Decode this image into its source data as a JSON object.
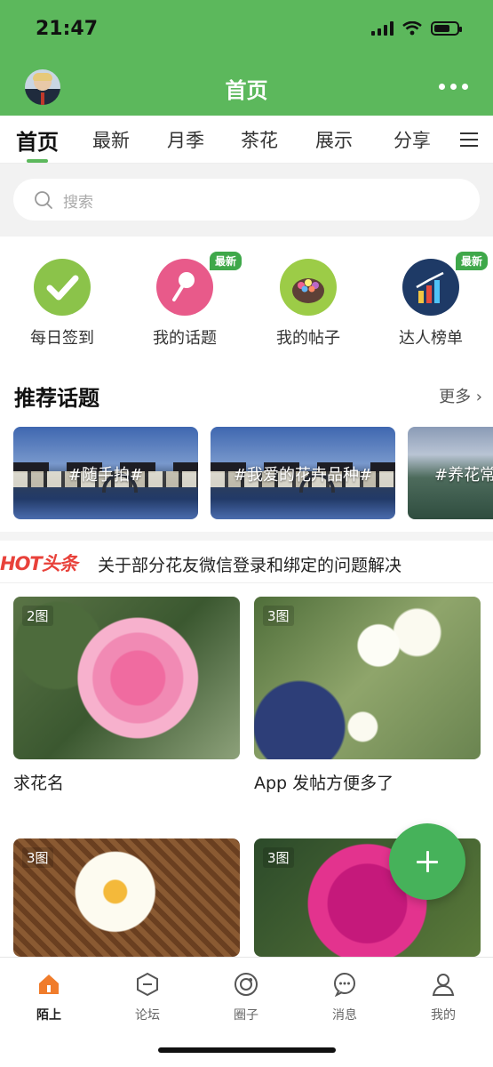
{
  "status_bar": {
    "time": "21:47"
  },
  "header": {
    "title": "首页",
    "more_icon": "more-dots-icon"
  },
  "tabs": [
    {
      "label": "首页",
      "active": true
    },
    {
      "label": "最新"
    },
    {
      "label": "月季"
    },
    {
      "label": "茶花"
    },
    {
      "label": "展示"
    },
    {
      "label": "分享"
    }
  ],
  "search": {
    "placeholder": "搜索"
  },
  "quick_actions": [
    {
      "label": "每日签到",
      "icon": "checkmark-icon"
    },
    {
      "label": "我的话题",
      "icon": "pin-icon",
      "badge": "最新"
    },
    {
      "label": "我的帖子",
      "icon": "flower-basket-icon"
    },
    {
      "label": "达人榜单",
      "icon": "bar-chart-icon",
      "badge": "最新"
    }
  ],
  "recommended": {
    "title": "推荐话题",
    "more": "更多 ›",
    "topics": [
      "#随手拍#",
      "#我爱的花卉品种#",
      "#养花常"
    ]
  },
  "hot": {
    "logo": "HOT头条",
    "headline": "关于部分花友微信登录和绑定的问题解决"
  },
  "posts": [
    {
      "count": "2图",
      "title": "求花名"
    },
    {
      "count": "3图",
      "title": "App 发帖方便多了"
    },
    {
      "count": "3图",
      "title": ""
    },
    {
      "count": "3图",
      "title": ""
    }
  ],
  "bottom_nav": [
    {
      "label": "陌上",
      "icon": "home-icon",
      "active": true
    },
    {
      "label": "论坛",
      "icon": "forum-icon"
    },
    {
      "label": "圈子",
      "icon": "circle-icon"
    },
    {
      "label": "消息",
      "icon": "message-icon"
    },
    {
      "label": "我的",
      "icon": "profile-icon"
    }
  ],
  "colors": {
    "brand_green": "#5cb85c",
    "hot_red": "#e8413a",
    "nav_active": "#f07c2b"
  }
}
